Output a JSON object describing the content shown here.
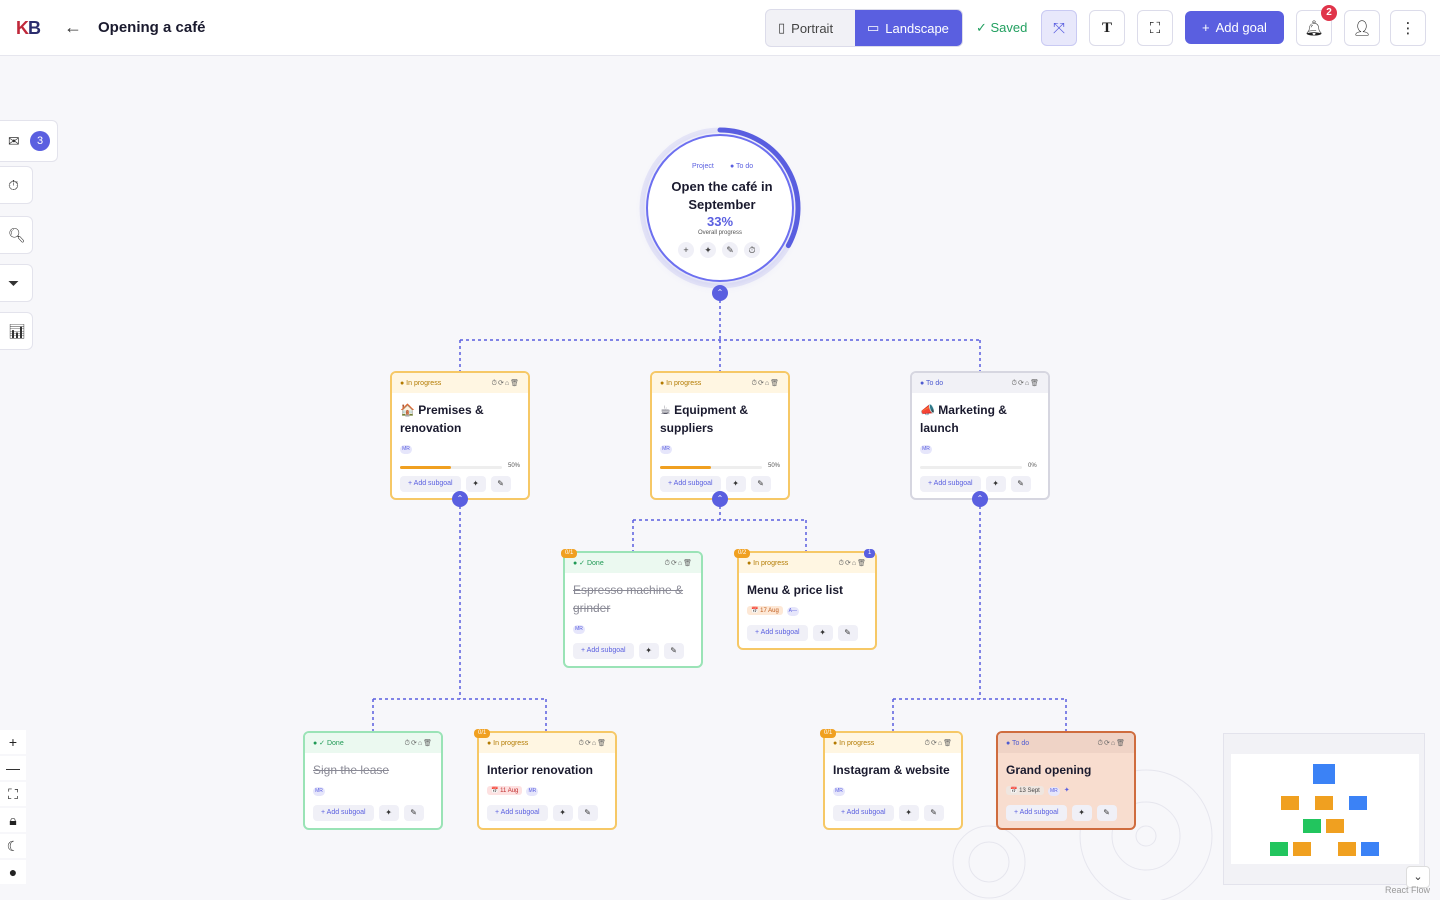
{
  "header": {
    "logo_k": "K",
    "logo_b": "B",
    "back_icon": "←",
    "title": "Opening a café",
    "portrait": "Portrait",
    "landscape": "Landscape",
    "saved": "✓ Saved",
    "add_goal": "Add goal",
    "notif_count": "2"
  },
  "sidebar": {
    "inbox_count": "3"
  },
  "root": {
    "project": "Project",
    "status": "● To do",
    "title": "Open the café in September",
    "percent": "33%",
    "overall": "Overall progress",
    "progress": 0.33
  },
  "cards": {
    "premises": {
      "status": "● In progress",
      "title": "🏠 Premises & renovation",
      "avatar": "MR",
      "percent": "50%",
      "progress": 0.5,
      "add": "+ Add subgoal"
    },
    "equipment": {
      "status": "● In progress",
      "title": "☕ Equipment & suppliers",
      "avatar": "MR",
      "percent": "50%",
      "progress": 0.5,
      "add": "+ Add subgoal"
    },
    "marketing": {
      "status": "● To do",
      "title": "📣 Marketing & launch",
      "avatar": "MR",
      "percent": "0%",
      "progress": 0,
      "add": "+ Add subgoal"
    },
    "espresso": {
      "chip": "0/1",
      "status": "● ✓ Done",
      "title": "Espresso machine & grinder",
      "avatar": "MR",
      "add": "+ Add subgoal"
    },
    "menu": {
      "chip": "0/2",
      "comment": "1",
      "status": "● In progress",
      "title": "Menu & price list",
      "date": "📅 17 Aug",
      "assignee": "A—",
      "add": "+ Add subgoal"
    },
    "lease": {
      "status": "● ✓ Done",
      "title": "Sign the lease",
      "avatar": "MR",
      "add": "+ Add subgoal"
    },
    "interior": {
      "chip": "0/1",
      "status": "● In progress",
      "title": "Interior renovation",
      "date": "📅 11 Aug",
      "avatar": "MR",
      "add": "+ Add subgoal"
    },
    "instagram": {
      "chip": "0/1",
      "status": "● In progress",
      "title": "Instagram & website",
      "avatar": "MR",
      "add": "+ Add subgoal"
    },
    "grand": {
      "status": "● To do",
      "title": "Grand opening",
      "date": "📅 13 Sept",
      "avatar": "MR",
      "add": "+ Add subgoal"
    }
  },
  "attribution": "React Flow",
  "colors": {
    "accent": "#5a5fe0",
    "in_progress": "#f6c866",
    "done": "#9ae3b6",
    "todo": "#d6d6e0"
  }
}
